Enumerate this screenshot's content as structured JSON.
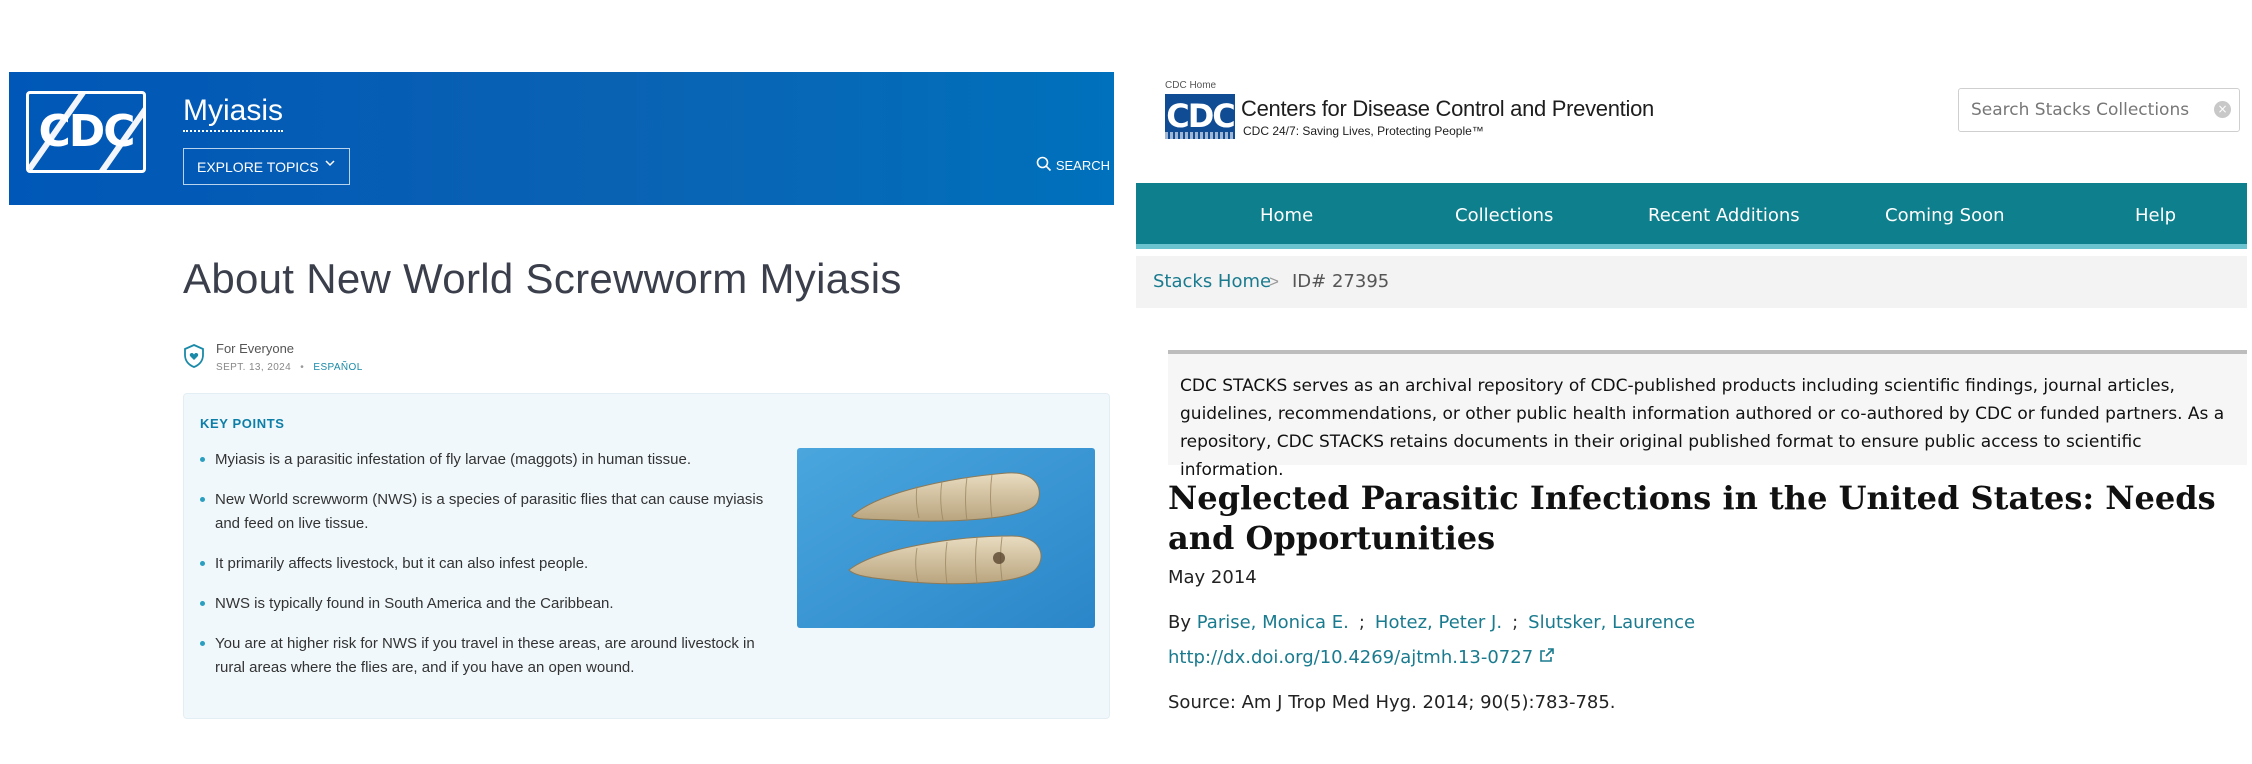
{
  "left": {
    "header": {
      "logo_text": "CDC",
      "site_title": "Myiasis",
      "explore_label": "EXPLORE TOPICS",
      "search_label": "SEARCH",
      "bg_color": "#0057b7"
    },
    "page_title": "About New World Screwworm Myiasis",
    "audience": "For Everyone",
    "date": "SEPT. 13, 2024",
    "language_link": "ESPAÑOL",
    "key_points": {
      "title": "KEY POINTS",
      "items": [
        "Myiasis is a parasitic infestation of fly larvae (maggots) in human tissue.",
        "New World screwworm (NWS) is a species of parasitic flies that can cause myiasis and feed on live tissue.",
        "It primarily affects livestock, but it can also infest people.",
        "NWS is typically found in South America and the Caribbean.",
        "You are at higher risk for NWS if you travel in these areas, are around livestock in rural areas where the flies are, and if you have an open wound."
      ]
    }
  },
  "right": {
    "cdc_home": "CDC Home",
    "logo_text": "CDC",
    "org_name": "Centers for Disease Control and Prevention",
    "org_tagline": "CDC 24/7: Saving Lives, Protecting People™",
    "search_placeholder": "Search Stacks Collections",
    "nav": [
      "Home",
      "Collections",
      "Recent Additions",
      "Coming Soon",
      "Help"
    ],
    "nav_color": "#0e7f8c",
    "breadcrumb": {
      "home": "Stacks Home",
      "separator": ">",
      "current": "ID# 27395"
    },
    "notice": "CDC STACKS serves as an archival repository of CDC-published products including scientific findings, journal articles, guidelines, recommendations, or other public health information authored or co-authored by CDC or funded partners. As a repository, CDC STACKS retains documents in their original published format to ensure public access to scientific information.",
    "doc_title": "Neglected Parasitic Infections in the United States: Needs and Opportunities",
    "doc_date": "May 2014",
    "by_label": "By",
    "authors": [
      "Parise, Monica E.",
      "Hotez, Peter J.",
      "Slutsker, Laurence"
    ],
    "author_separator": ";",
    "doi": "http://dx.doi.org/10.4269/ajtmh.13-0727",
    "source": "Source: Am J Trop Med Hyg. 2014; 90(5):783-785."
  }
}
